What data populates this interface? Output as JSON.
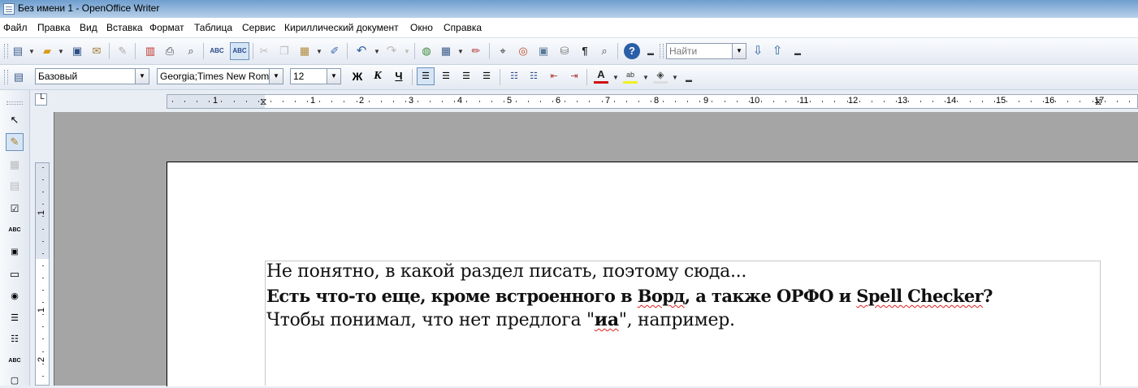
{
  "window": {
    "title": "Без имени 1 - OpenOffice Writer"
  },
  "menu": [
    "Файл",
    "Правка",
    "Вид",
    "Вставка",
    "Формат",
    "Таблица",
    "Сервис",
    "Кириллический документ",
    "Окно",
    "Справка"
  ],
  "toolbar": {
    "find_placeholder": "Найти"
  },
  "format_toolbar": {
    "style": "Базовый",
    "font": "Georgia;Times New Roma",
    "size": "12",
    "bold_label": "Ж",
    "italic_label": "К",
    "underline_label": "Ч"
  },
  "ruler": {
    "h_numbers": [
      "1",
      "1",
      "2",
      "3",
      "4",
      "5",
      "6",
      "7",
      "8",
      "9",
      "10",
      "11",
      "12",
      "13",
      "14",
      "15",
      "16",
      "17"
    ],
    "v_numbers": [
      "1",
      "1",
      "2"
    ]
  },
  "document": {
    "line1": "Не понятно, в какой раздел писать, поэтому сюда...",
    "line2_before": "Есть что-то еще, кроме встроенного в ",
    "line2_err1": "Ворд",
    "line2_mid": ", а также ОРФО и ",
    "line2_err2": "Spell Checker",
    "line2_end": "?",
    "line3_before": "Чтобы понимал, что нет предлога \"",
    "line3_err": "иа",
    "line3_end": "\", например."
  },
  "colors": {
    "spell_error": "#e02020",
    "titlebar": "#8fb4dc",
    "workspace": "#a5a5a5"
  },
  "icons": [
    "new-document-icon",
    "open-icon",
    "save-icon",
    "email-icon",
    "edit-file-icon",
    "export-pdf-icon",
    "print-icon",
    "print-preview-icon",
    "spellcheck-icon",
    "autospellcheck-icon",
    "cut-icon",
    "copy-icon",
    "paste-icon",
    "format-paintbrush-icon",
    "undo-icon",
    "redo-icon",
    "hyperlink-icon",
    "table-icon",
    "draw-functions-icon",
    "find-replace-icon",
    "navigator-icon",
    "gallery-icon",
    "data-sources-icon",
    "nonprinting-chars-icon",
    "zoom-icon",
    "help-icon",
    "find-next-icon",
    "find-previous-icon"
  ]
}
